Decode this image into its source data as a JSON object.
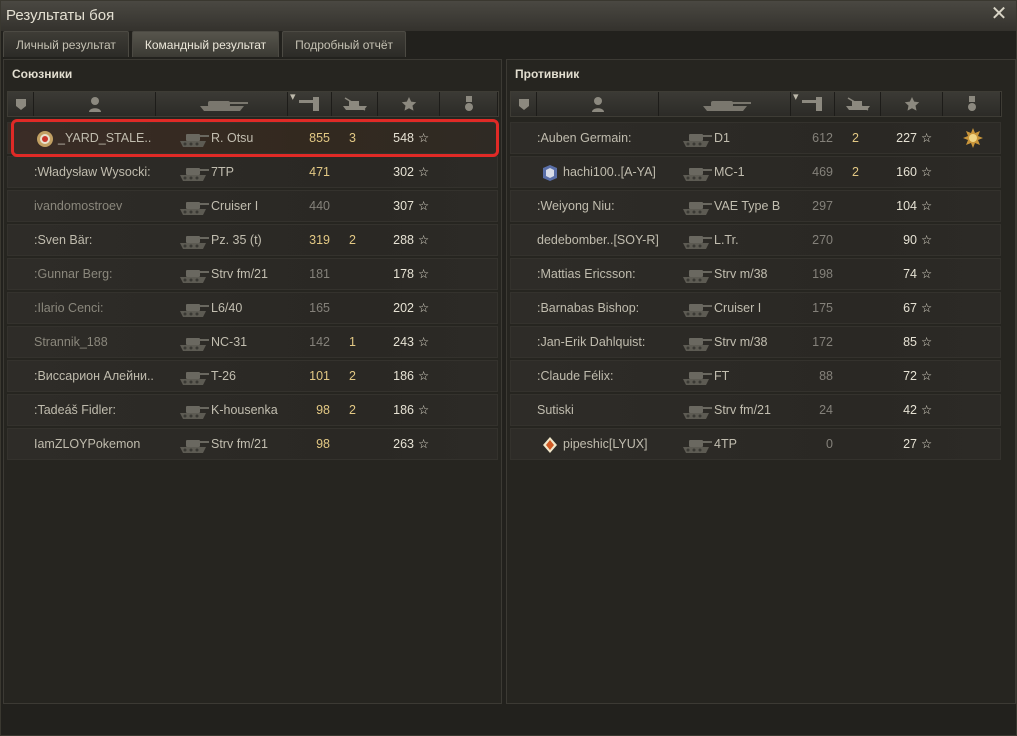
{
  "window": {
    "title": "Результаты боя",
    "close_glyph": "✕"
  },
  "tabs": [
    {
      "label": "Личный результат",
      "active": false
    },
    {
      "label": "Командный результат",
      "active": true
    },
    {
      "label": "Подробный отчёт",
      "active": false
    }
  ],
  "allies": {
    "title": "Союзники",
    "rows": [
      {
        "name": "_YARD_STALE..",
        "tank": "R. Otsu",
        "damage": "855",
        "kills": "3",
        "xp": "548",
        "badge": "clan-25-icon",
        "highlighted": true
      },
      {
        "name": ":Władysław Wysocki:",
        "tank": "7TP",
        "damage": "471",
        "kills": "",
        "xp": "302"
      },
      {
        "name": "ivandomostroev",
        "tank": "Cruiser I",
        "damage": "440",
        "kills": "",
        "xp": "307",
        "dim": true
      },
      {
        "name": ":Sven Bär:",
        "tank": "Pz. 35 (t)",
        "damage": "319",
        "kills": "2",
        "xp": "288"
      },
      {
        "name": ":Gunnar Berg:",
        "tank": "Strv fm/21",
        "damage": "181",
        "kills": "",
        "xp": "178",
        "dim": true
      },
      {
        "name": ":Ilario Cenci:",
        "tank": "L6/40",
        "damage": "165",
        "kills": "",
        "xp": "202",
        "dim": true
      },
      {
        "name": "Strannik_188",
        "tank": "NC-31",
        "damage": "142",
        "kills": "1",
        "xp": "243",
        "dim": true
      },
      {
        "name": ":Виссарион Алейни..",
        "tank": "T-26",
        "damage": "101",
        "kills": "2",
        "xp": "186"
      },
      {
        "name": ":Tadeáš Fidler:",
        "tank": "K-housenka",
        "damage": "98",
        "kills": "2",
        "xp": "186"
      },
      {
        "name": "IamZLOYPokemon",
        "tank": "Strv fm/21",
        "damage": "98",
        "kills": "",
        "xp": "263"
      }
    ]
  },
  "enemies": {
    "title": "Противник",
    "rows": [
      {
        "name": ":Auben Germain:",
        "tank": "D1",
        "damage": "612",
        "kills": "2",
        "xp": "227",
        "medal": "sun-medal-icon",
        "dim": true
      },
      {
        "name": "hachi100..[A-YA]",
        "tank": "MC-1",
        "damage": "469",
        "kills": "2",
        "xp": "160",
        "badge": "clan-icon",
        "dim": true
      },
      {
        "name": ":Weiyong Niu:",
        "tank": "VAE Type B",
        "damage": "297",
        "kills": "",
        "xp": "104",
        "dim": true
      },
      {
        "name": "dedebomber..[SOY-R]",
        "tank": "L.Tr.",
        "damage": "270",
        "kills": "",
        "xp": "90",
        "dim": true
      },
      {
        "name": ":Mattias Ericsson:",
        "tank": "Strv m/38",
        "damage": "198",
        "kills": "",
        "xp": "74",
        "dim": true
      },
      {
        "name": ":Barnabas Bishop:",
        "tank": "Cruiser I",
        "damage": "175",
        "kills": "",
        "xp": "67",
        "dim": true
      },
      {
        "name": ":Jan-Erik Dahlquist:",
        "tank": "Strv m/38",
        "damage": "172",
        "kills": "",
        "xp": "85",
        "dim": true
      },
      {
        "name": ":Claude Félix:",
        "tank": "FT",
        "damage": "88",
        "kills": "",
        "xp": "72",
        "dim": true
      },
      {
        "name": "Sutiski",
        "tank": "Strv fm/21",
        "damage": "24",
        "kills": "",
        "xp": "42",
        "dim": true
      },
      {
        "name": "pipeshic[LYUX]",
        "tank": "4TP",
        "damage": "0",
        "kills": "",
        "xp": "27",
        "badge": "clan-diamond-icon",
        "dim": true
      }
    ]
  },
  "columns": [
    "squad-icon",
    "player-icon",
    "tank-icon",
    "damage-icon",
    "kills-icon",
    "xp-star-icon",
    "medal-icon"
  ],
  "star_glyph": "☆",
  "colors": {
    "highlight": "#e02a26",
    "damage": "#e2c884",
    "text": "#c0bcae"
  }
}
